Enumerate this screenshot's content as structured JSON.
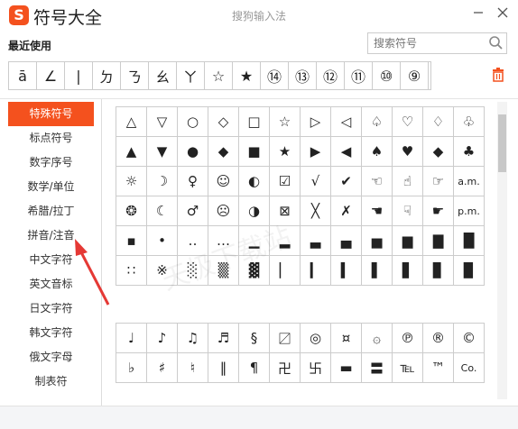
{
  "app": {
    "logo": "S",
    "title": "符号大全",
    "window_title": "搜狗输入法"
  },
  "recent": {
    "label": "最近使用",
    "symbols": [
      "ā",
      "∠",
      "|",
      "ㄉ",
      "ㄋ",
      "ㄠ",
      "ㄚ",
      "☆",
      "★",
      "⑭",
      "⑬",
      "⑫",
      "⑪",
      "⑩",
      "⑨"
    ]
  },
  "search": {
    "placeholder": "搜索符号"
  },
  "sidebar": {
    "items": [
      {
        "label": "特殊符号",
        "active": true
      },
      {
        "label": "标点符号"
      },
      {
        "label": "数字序号"
      },
      {
        "label": "数学/单位"
      },
      {
        "label": "希腊/拉丁"
      },
      {
        "label": "拼音/注音"
      },
      {
        "label": "中文字符"
      },
      {
        "label": "英文音标"
      },
      {
        "label": "日文字符"
      },
      {
        "label": "韩文字符"
      },
      {
        "label": "俄文字母"
      },
      {
        "label": "制表符"
      }
    ]
  },
  "grid1": [
    [
      "△",
      "▽",
      "○",
      "◇",
      "□",
      "☆",
      "▷",
      "◁",
      "♤",
      "♡",
      "♢",
      "♧"
    ],
    [
      "▲",
      "▼",
      "●",
      "◆",
      "■",
      "★",
      "▶",
      "◀",
      "♠",
      "♥",
      "◆",
      "♣"
    ],
    [
      "☼",
      "☽",
      "♀",
      "☺",
      "◐",
      "☑",
      "√",
      "✔",
      "☜",
      "☝",
      "☞",
      "a.m."
    ],
    [
      "❂",
      "☾",
      "♂",
      "☹",
      "◑",
      "⊠",
      "╳",
      "✗",
      "☚",
      "☟",
      "☛",
      "p.m."
    ],
    [
      "▪",
      "•",
      "‥",
      "…",
      "▁",
      "▂",
      "▃",
      "▄",
      "▅",
      "▆",
      "▇",
      "█"
    ],
    [
      "∷",
      "※",
      "░",
      "▒",
      "▓",
      "▏",
      "▎",
      "▍",
      "▌",
      "▋",
      "▊",
      "▉"
    ]
  ],
  "grid2": [
    [
      "♩",
      "♪",
      "♫",
      "♬",
      "§",
      "〼",
      "◎",
      "¤",
      "۞",
      "℗",
      "®",
      "©"
    ],
    [
      "♭",
      "♯",
      "♮",
      "‖",
      "¶",
      "卍",
      "卐",
      "▬",
      "〓",
      "℡",
      "™",
      "Co."
    ]
  ],
  "watermark": "天极下载站",
  "colors": {
    "accent": "#f4511e"
  }
}
